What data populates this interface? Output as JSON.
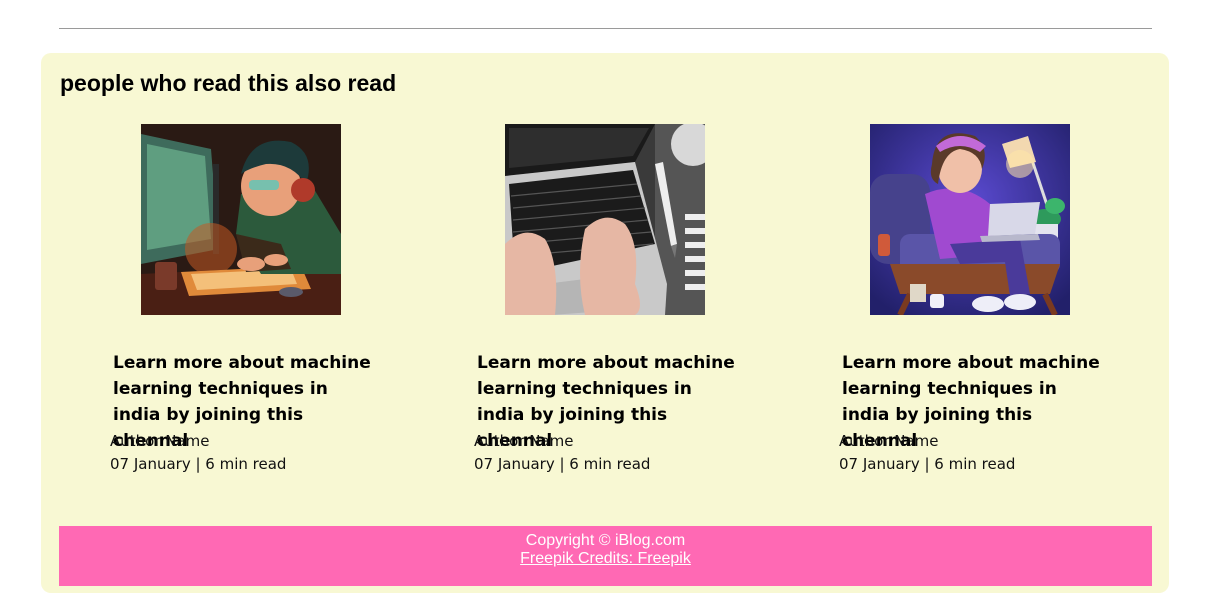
{
  "section": {
    "title": "people who read this also read"
  },
  "articles": [
    {
      "image": "boy-gaming-at-computer-illustration",
      "title": "Learn more about machine learning techniques in india by joining this chennal",
      "author": "Author Name",
      "meta": "07 January | 6 min read"
    },
    {
      "image": "hands-typing-on-laptop-photo",
      "title": "Learn more about machine learning techniques in india by joining this chennal",
      "author": "Author Name",
      "meta": "07 January | 6 min read"
    },
    {
      "image": "girl-with-laptop-on-armchair-illustration",
      "title": "Learn more about machine learning techniques in india by joining this chennal",
      "author": "Author Name",
      "meta": "07 January | 6 min read"
    }
  ],
  "footer": {
    "copyright": "Copyright © iBlog.com",
    "credits_link": "Freepik Credits: Freepik"
  },
  "colors": {
    "panel_bg": "#f8f8d3",
    "footer_bg": "#ff69b4",
    "footer_text": "#ffffff"
  }
}
